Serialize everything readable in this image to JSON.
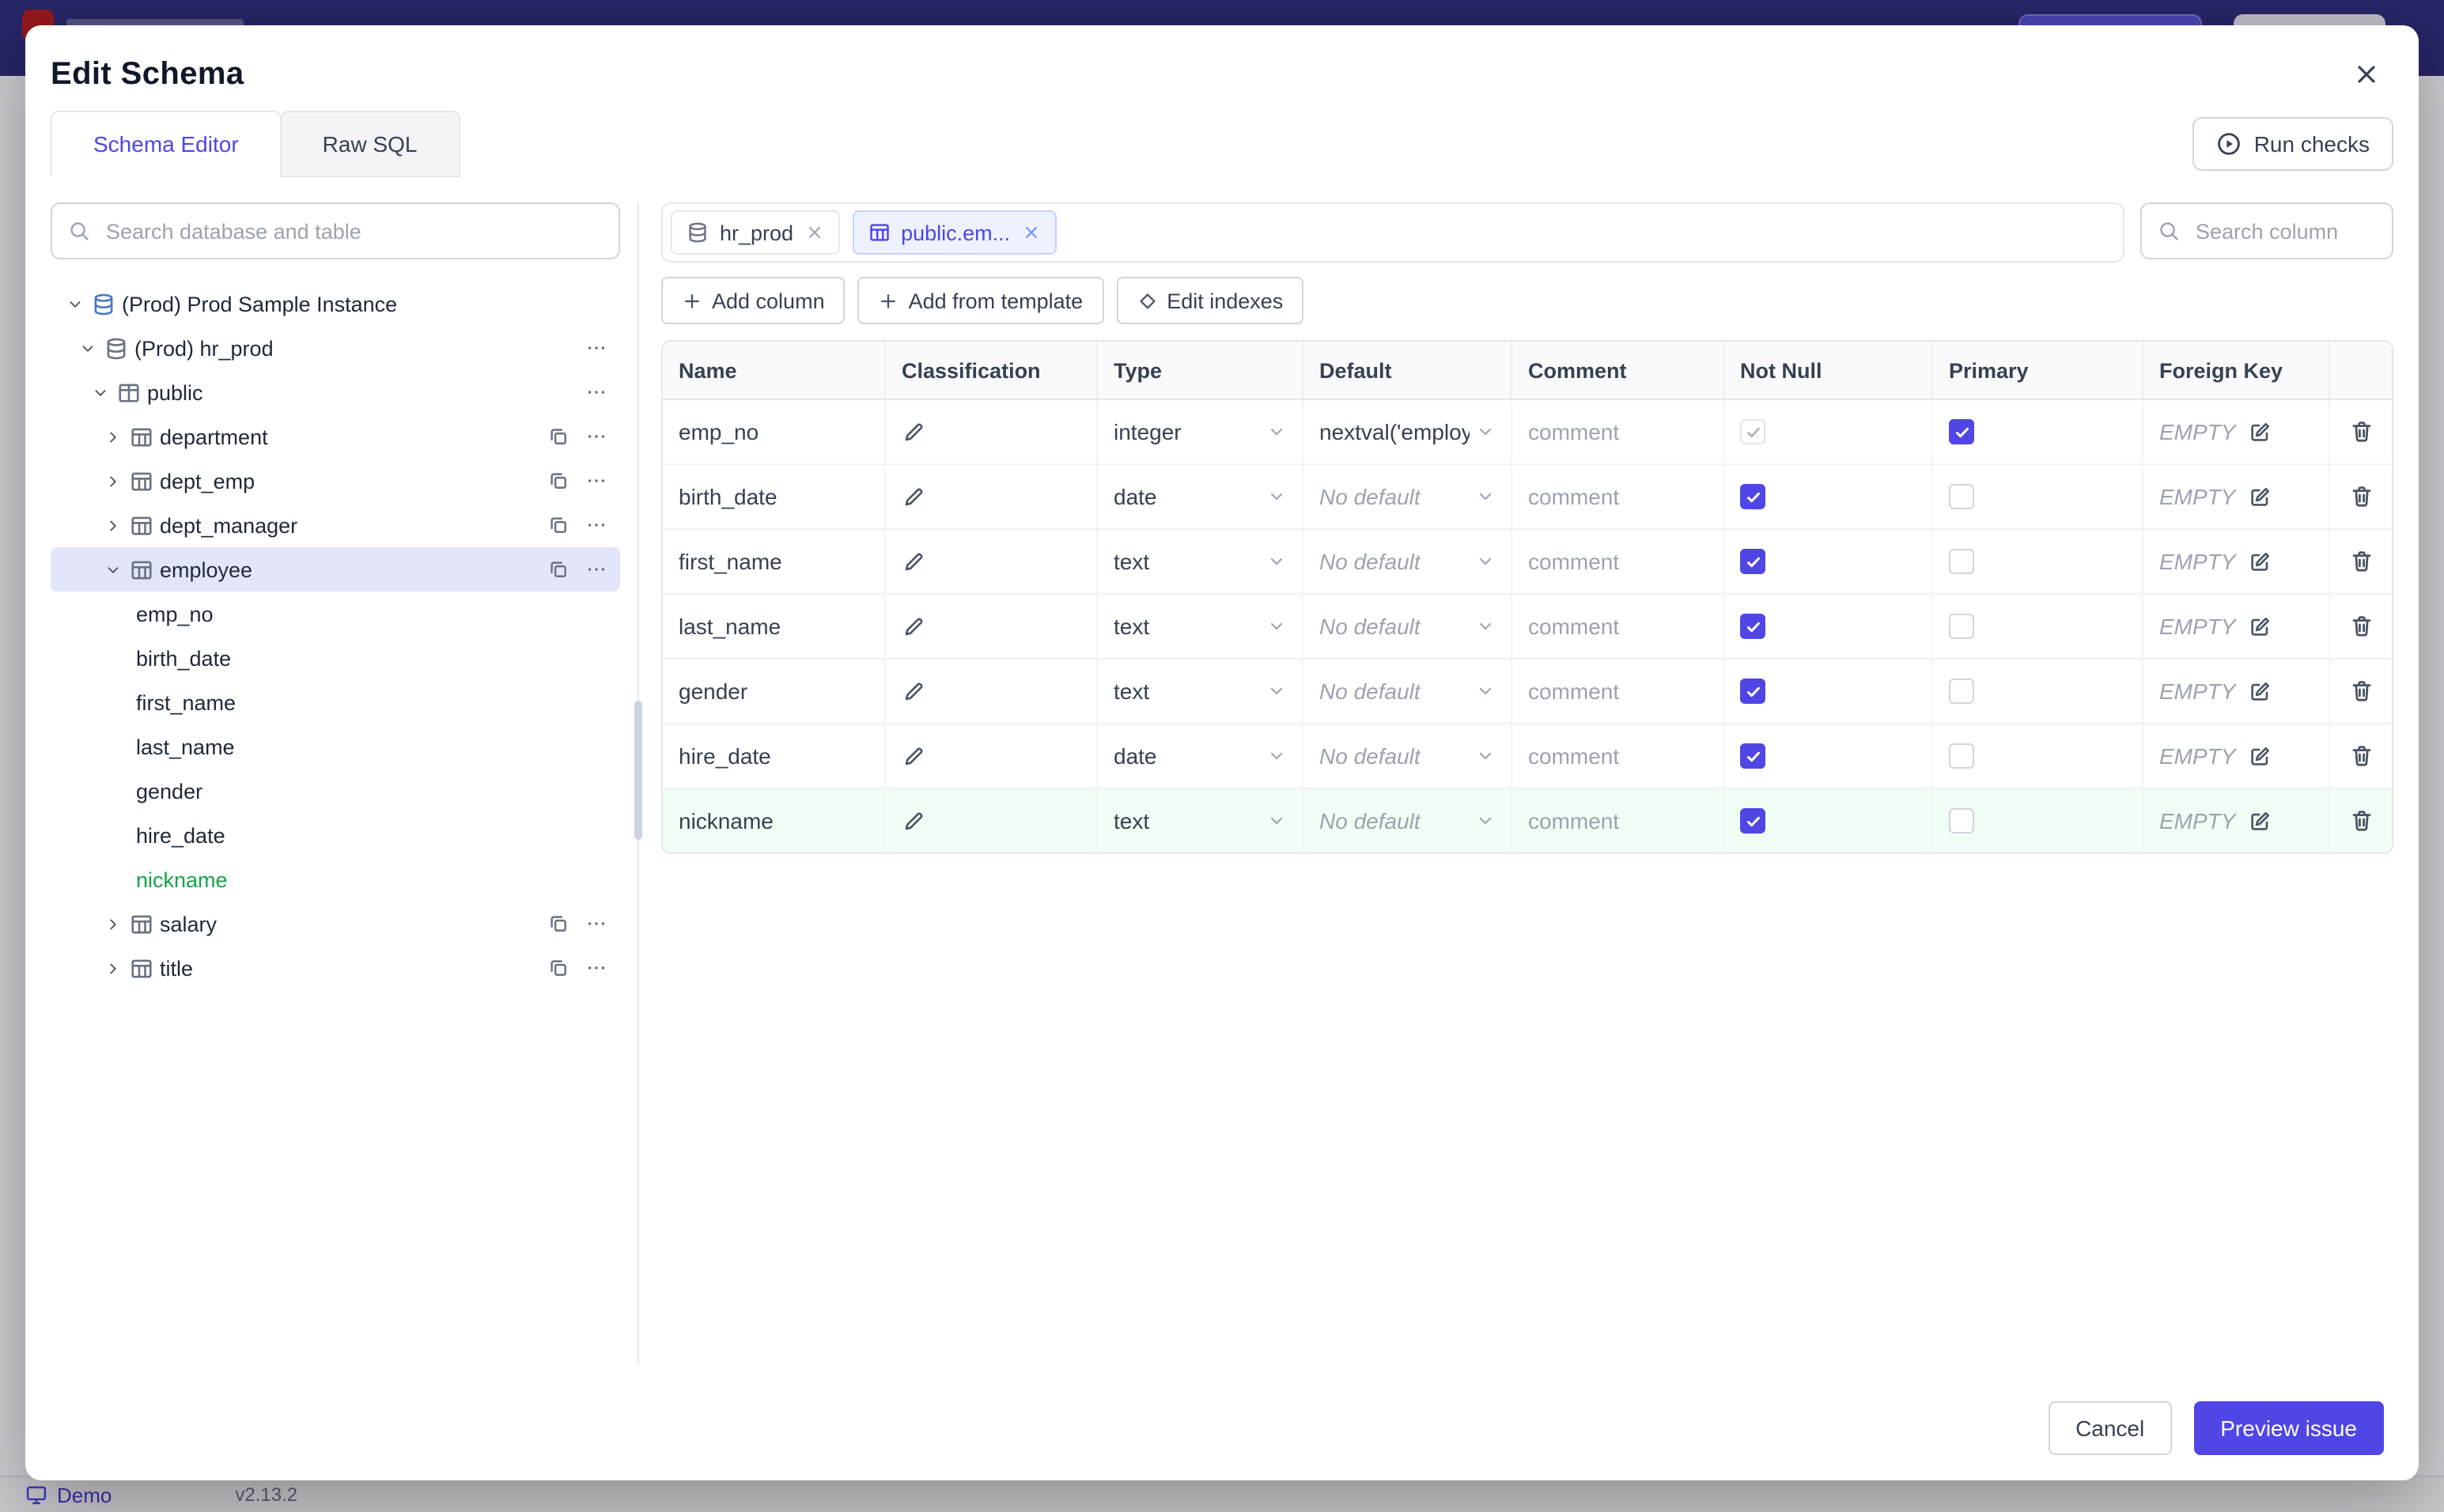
{
  "status_bar": {
    "demo_label": "Demo",
    "version": "v2.13.2"
  },
  "modal": {
    "title": "Edit Schema",
    "tabs": [
      {
        "label": "Schema Editor",
        "active": true
      },
      {
        "label": "Raw SQL",
        "active": false
      }
    ],
    "run_checks_label": "Run checks",
    "sidebar": {
      "search_placeholder": "Search database and table",
      "tree": [
        {
          "label": "(Prod) Prod Sample Instance",
          "kind": "instance",
          "level": 0,
          "icon": "postgres",
          "chevron": "down",
          "actions": []
        },
        {
          "label": "(Prod) hr_prod",
          "kind": "database",
          "level": 1,
          "icon": "database",
          "chevron": "down",
          "actions": [
            "ellipsis"
          ]
        },
        {
          "label": "public",
          "kind": "schema",
          "level": 2,
          "icon": "schema",
          "chevron": "down",
          "actions": [
            "ellipsis"
          ]
        },
        {
          "label": "department",
          "kind": "table",
          "level": 3,
          "icon": "table",
          "chevron": "right",
          "actions": [
            "copy",
            "ellipsis"
          ]
        },
        {
          "label": "dept_emp",
          "kind": "table",
          "level": 3,
          "icon": "table",
          "chevron": "right",
          "actions": [
            "copy",
            "ellipsis"
          ]
        },
        {
          "label": "dept_manager",
          "kind": "table",
          "level": 3,
          "icon": "table",
          "chevron": "right",
          "actions": [
            "copy",
            "ellipsis"
          ]
        },
        {
          "label": "employee",
          "kind": "table",
          "level": 3,
          "icon": "table",
          "chevron": "down",
          "selected": true,
          "actions": [
            "copy",
            "ellipsis"
          ]
        },
        {
          "label": "emp_no",
          "kind": "column",
          "level": 4
        },
        {
          "label": "birth_date",
          "kind": "column",
          "level": 4
        },
        {
          "label": "first_name",
          "kind": "column",
          "level": 4
        },
        {
          "label": "last_name",
          "kind": "column",
          "level": 4
        },
        {
          "label": "gender",
          "kind": "column",
          "level": 4
        },
        {
          "label": "hire_date",
          "kind": "column",
          "level": 4
        },
        {
          "label": "nickname",
          "kind": "column",
          "level": 4,
          "added": true
        },
        {
          "label": "salary",
          "kind": "table",
          "level": 3,
          "icon": "table",
          "chevron": "right",
          "actions": [
            "copy",
            "ellipsis"
          ]
        },
        {
          "label": "title",
          "kind": "table",
          "level": 3,
          "icon": "table",
          "chevron": "right",
          "actions": [
            "copy",
            "ellipsis"
          ]
        }
      ]
    },
    "editor": {
      "open_tabs": [
        {
          "label": "hr_prod",
          "icon": "database",
          "selected": false
        },
        {
          "label": "public.em...",
          "icon": "table",
          "selected": true
        }
      ],
      "column_search_placeholder": "Search column",
      "toolbar": [
        {
          "label": "Add column",
          "icon": "plus"
        },
        {
          "label": "Add from template",
          "icon": "plus"
        },
        {
          "label": "Edit indexes",
          "icon": "diamond"
        }
      ],
      "table": {
        "headers": [
          "Name",
          "Classification",
          "Type",
          "Default",
          "Comment",
          "Not Null",
          "Primary",
          "Foreign Key",
          ""
        ],
        "comment_placeholder": "comment",
        "foreign_key_placeholder": "EMPTY",
        "rows": [
          {
            "name": "emp_no",
            "type": "integer",
            "default": "nextval('employ",
            "default_is_placeholder": false,
            "not_null": true,
            "not_null_disabled": true,
            "primary": true,
            "added": false
          },
          {
            "name": "birth_date",
            "type": "date",
            "default": "No default",
            "default_is_placeholder": true,
            "not_null": true,
            "not_null_disabled": false,
            "primary": false,
            "added": false
          },
          {
            "name": "first_name",
            "type": "text",
            "default": "No default",
            "default_is_placeholder": true,
            "not_null": true,
            "not_null_disabled": false,
            "primary": false,
            "added": false
          },
          {
            "name": "last_name",
            "type": "text",
            "default": "No default",
            "default_is_placeholder": true,
            "not_null": true,
            "not_null_disabled": false,
            "primary": false,
            "added": false
          },
          {
            "name": "gender",
            "type": "text",
            "default": "No default",
            "default_is_placeholder": true,
            "not_null": true,
            "not_null_disabled": false,
            "primary": false,
            "added": false
          },
          {
            "name": "hire_date",
            "type": "date",
            "default": "No default",
            "default_is_placeholder": true,
            "not_null": true,
            "not_null_disabled": false,
            "primary": false,
            "added": false
          },
          {
            "name": "nickname",
            "type": "text",
            "default": "No default",
            "default_is_placeholder": true,
            "not_null": true,
            "not_null_disabled": false,
            "primary": false,
            "added": true
          }
        ]
      }
    },
    "footer": {
      "cancel_label": "Cancel",
      "submit_label": "Preview issue"
    }
  },
  "colors": {
    "accent": "#4f46e5",
    "added_text": "#16a34a",
    "added_row_bg": "#f0fdf4",
    "selected_tree_bg": "#e3e6fb"
  }
}
